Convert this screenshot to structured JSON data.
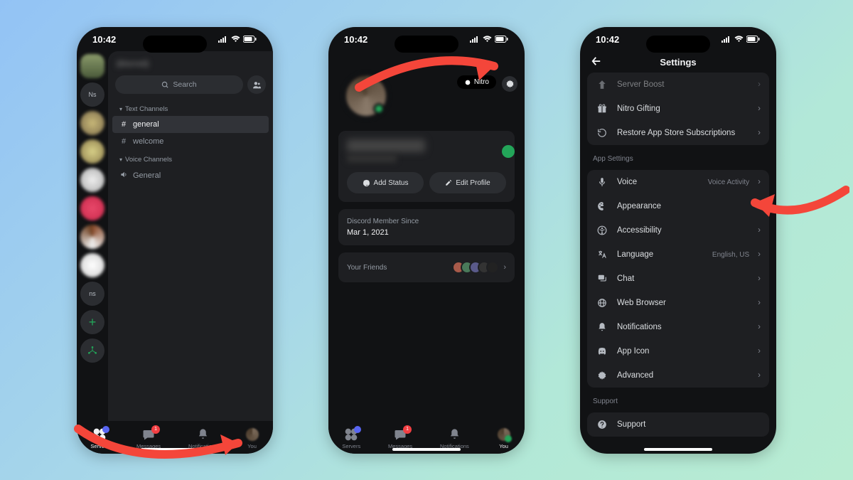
{
  "statusbar": {
    "time": "10:42"
  },
  "screen1": {
    "server_title": "(blurred)",
    "search_placeholder": "Search",
    "server_labels": {
      "ns1": "Ns",
      "ns2": "ns"
    },
    "sections": {
      "text_label": "Text Channels",
      "voice_label": "Voice Channels"
    },
    "channels": {
      "general": "general",
      "welcome": "welcome",
      "voice_general": "General"
    }
  },
  "tabbar": {
    "servers": "Servers",
    "messages": "Messages",
    "notifications": "Notifications",
    "you": "You",
    "messages_badge": "1"
  },
  "screen2": {
    "nitro": "Nitro",
    "add_status": "Add Status",
    "edit_profile": "Edit Profile",
    "member_since_label": "Discord Member Since",
    "member_since_value": "Mar 1, 2021",
    "your_friends": "Your Friends"
  },
  "screen3": {
    "title": "Settings",
    "server_boost": "Server Boost",
    "nitro_gifting": "Nitro Gifting",
    "restore": "Restore App Store Subscriptions",
    "app_settings": "App Settings",
    "voice": "Voice",
    "voice_value": "Voice Activity",
    "appearance": "Appearance",
    "accessibility": "Accessibility",
    "language": "Language",
    "language_value": "English, US",
    "chat": "Chat",
    "web_browser": "Web Browser",
    "notifications": "Notifications",
    "app_icon": "App Icon",
    "advanced": "Advanced",
    "support_section": "Support",
    "support": "Support"
  }
}
